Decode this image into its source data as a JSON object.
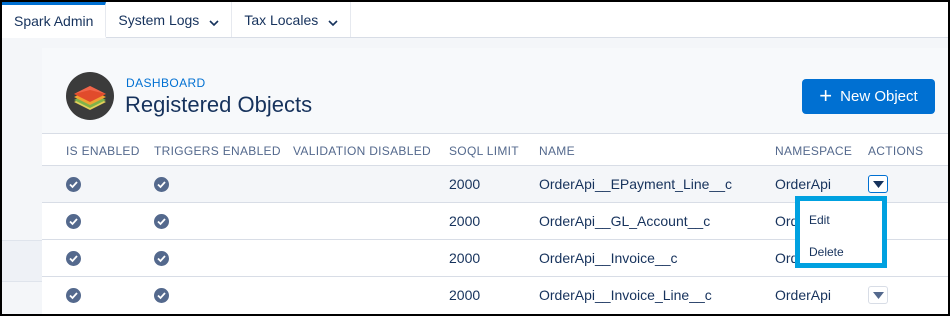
{
  "tabs": [
    {
      "label": "Spark Admin",
      "active": true,
      "has_menu": false
    },
    {
      "label": "System Logs",
      "active": false,
      "has_menu": true
    },
    {
      "label": "Tax Locales",
      "active": false,
      "has_menu": true
    }
  ],
  "header": {
    "eyebrow": "DASHBOARD",
    "title": "Registered Objects",
    "icon": "layers-stack-icon",
    "new_button_label": "New Object"
  },
  "table": {
    "columns": [
      "IS ENABLED",
      "TRIGGERS ENABLED",
      "VALIDATION DISABLED",
      "SOQL LIMIT",
      "NAME",
      "NAMESPACE",
      "ACTIONS"
    ],
    "rows": [
      {
        "is_enabled": true,
        "triggers_enabled": true,
        "validation_disabled": false,
        "soql_limit": "2000",
        "name": "OrderApi__EPayment_Line__c",
        "namespace": "OrderApi"
      },
      {
        "is_enabled": true,
        "triggers_enabled": true,
        "validation_disabled": false,
        "soql_limit": "2000",
        "name": "OrderApi__GL_Account__c",
        "namespace": "OrderApi"
      },
      {
        "is_enabled": true,
        "triggers_enabled": true,
        "validation_disabled": false,
        "soql_limit": "2000",
        "name": "OrderApi__Invoice__c",
        "namespace": "OrderApi"
      },
      {
        "is_enabled": true,
        "triggers_enabled": true,
        "validation_disabled": false,
        "soql_limit": "2000",
        "name": "OrderApi__Invoice_Line__c",
        "namespace": "OrderApi"
      }
    ]
  },
  "action_menu": {
    "items": [
      "Edit",
      "Delete"
    ]
  },
  "colors": {
    "brand": "#0070d2",
    "highlight": "#00a1e0",
    "text": "#16325c",
    "header_text": "#54698d"
  }
}
